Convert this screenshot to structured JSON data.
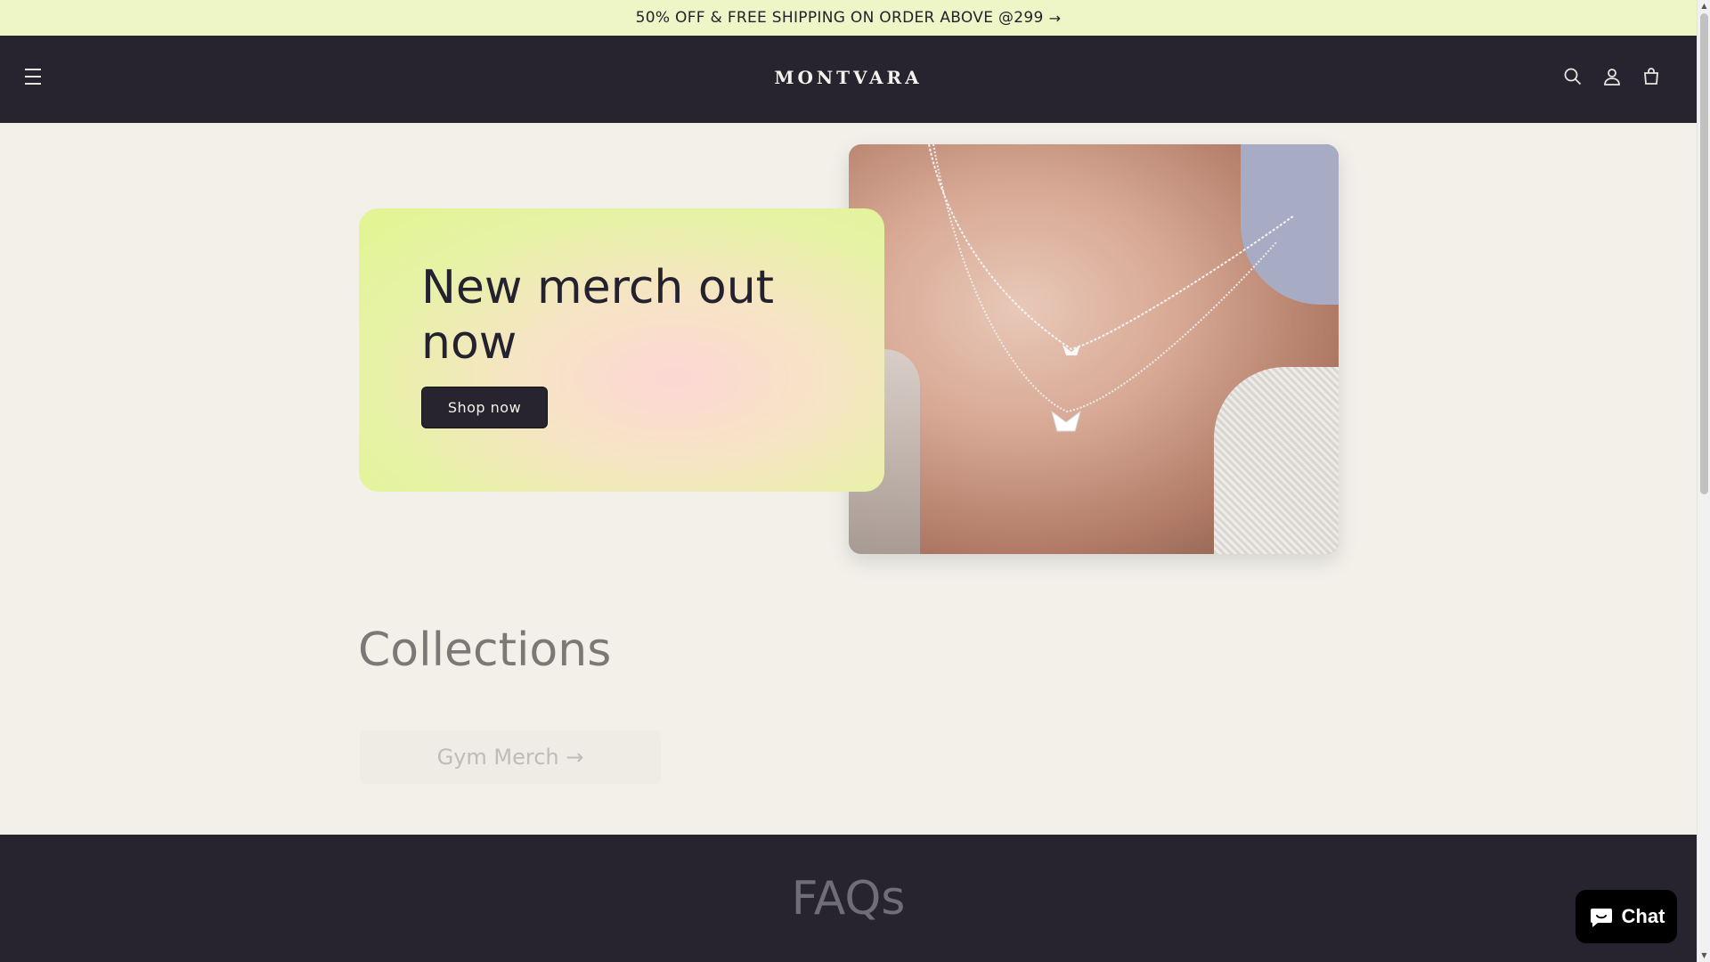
{
  "announcement": {
    "text": "50% OFF & FREE SHIPPING ON ORDER ABOVE @299",
    "arrow": "→"
  },
  "header": {
    "logo": "MONTVARA",
    "menu_icon": "hamburger-icon",
    "search_icon": "search-icon",
    "account_icon": "account-icon",
    "cart_icon": "cart-icon"
  },
  "hero": {
    "title": "New merch out now",
    "button_label": "Shop now",
    "image_alt": "necklace-photo"
  },
  "collections": {
    "title": "Collections",
    "items": [
      {
        "label": "Gym Merch →"
      },
      {
        "label": ""
      },
      {
        "label": ""
      }
    ]
  },
  "faq": {
    "title": "FAQs"
  },
  "chat": {
    "label": "Chat"
  },
  "colors": {
    "accent": "#e1f491",
    "dark": "#27242f",
    "background": "#f2f0e9"
  }
}
